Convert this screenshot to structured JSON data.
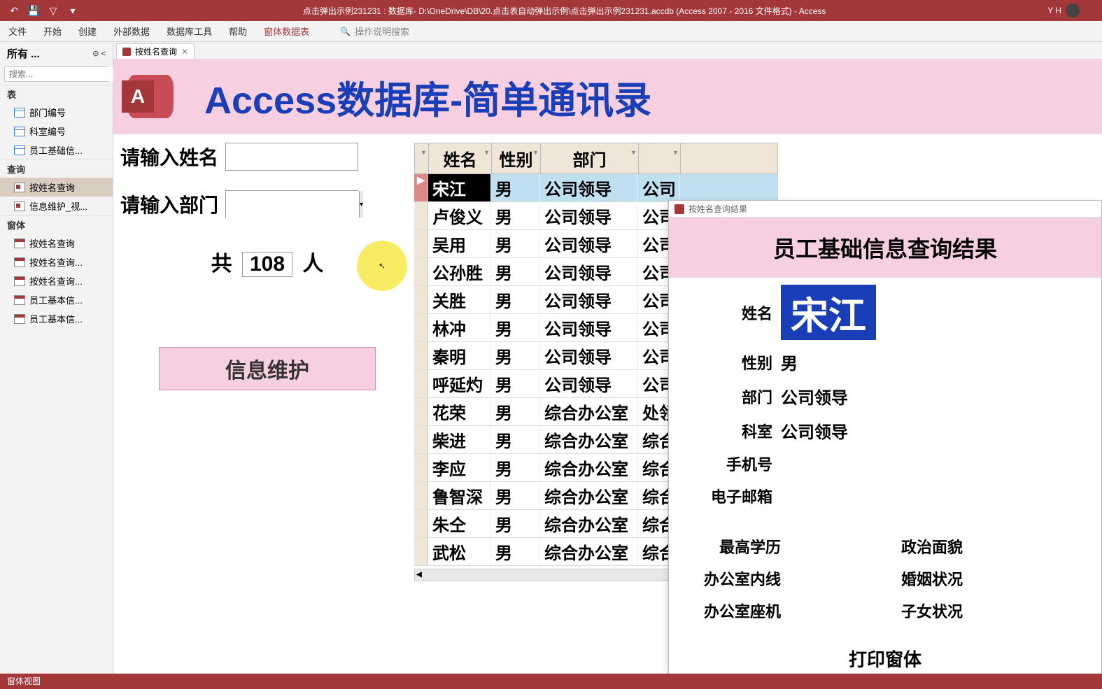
{
  "titlebar": {
    "title": "点击弹出示例231231 : 数据库- D:\\OneDrive\\DB\\20.点击表自动弹出示例\\点击弹出示例231231.accdb (Access 2007 - 2016 文件格式)  -  Access",
    "user": "Y H"
  },
  "ribbon": {
    "tabs": [
      "文件",
      "开始",
      "创建",
      "外部数据",
      "数据库工具",
      "帮助",
      "窗体数据表"
    ],
    "active": 6,
    "search_placeholder": "操作说明搜索"
  },
  "nav": {
    "title": "所有 ...",
    "search_placeholder": "搜索...",
    "groups": [
      {
        "name": "表",
        "type": "table",
        "items": [
          "部门编号",
          "科室编号",
          "员工基础信..."
        ]
      },
      {
        "name": "查询",
        "type": "query",
        "items": [
          "按姓名查询",
          "信息维护_视..."
        ],
        "selected": 0
      },
      {
        "name": "窗体",
        "type": "form",
        "items": [
          "按姓名查询",
          "按姓名查询...",
          "按姓名查询...",
          "员工基本信...",
          "员工基本信..."
        ]
      }
    ]
  },
  "doc_tab": {
    "label": "按姓名查询"
  },
  "form": {
    "banner_title": "Access数据库-简单通讯录",
    "name_label": "请输入姓名",
    "dept_label": "请输入部门",
    "count_prefix": "共",
    "count_value": "108",
    "count_suffix": "人",
    "maint_button": "信息维护"
  },
  "table": {
    "headers": [
      "姓名",
      "性别",
      "部门",
      ""
    ],
    "rows": [
      {
        "name": "宋江",
        "sex": "男",
        "dept": "公司领导",
        "extra": "公司",
        "selected": true
      },
      {
        "name": "卢俊义",
        "sex": "男",
        "dept": "公司领导",
        "extra": "公司"
      },
      {
        "name": "吴用",
        "sex": "男",
        "dept": "公司领导",
        "extra": "公司"
      },
      {
        "name": "公孙胜",
        "sex": "男",
        "dept": "公司领导",
        "extra": "公司"
      },
      {
        "name": "关胜",
        "sex": "男",
        "dept": "公司领导",
        "extra": "公司"
      },
      {
        "name": "林冲",
        "sex": "男",
        "dept": "公司领导",
        "extra": "公司"
      },
      {
        "name": "秦明",
        "sex": "男",
        "dept": "公司领导",
        "extra": "公司"
      },
      {
        "name": "呼延灼",
        "sex": "男",
        "dept": "公司领导",
        "extra": "公司"
      },
      {
        "name": "花荣",
        "sex": "男",
        "dept": "综合办公室",
        "extra": "处领"
      },
      {
        "name": "柴进",
        "sex": "男",
        "dept": "综合办公室",
        "extra": "综合"
      },
      {
        "name": "李应",
        "sex": "男",
        "dept": "综合办公室",
        "extra": "综合"
      },
      {
        "name": "鲁智深",
        "sex": "男",
        "dept": "综合办公室",
        "extra": "综合"
      },
      {
        "name": "朱仝",
        "sex": "男",
        "dept": "综合办公室",
        "extra": "综合"
      },
      {
        "name": "武松",
        "sex": "男",
        "dept": "综合办公室",
        "extra": "综合"
      }
    ]
  },
  "popup": {
    "tab_title": "按姓名查询结果",
    "header": "员工基础信息查询结果",
    "fields": {
      "name_lbl": "姓名",
      "name_val": "宋江",
      "sex_lbl": "性别",
      "sex_val": "男",
      "dept_lbl": "部门",
      "dept_val": "公司领导",
      "room_lbl": "科室",
      "room_val": "公司领导",
      "phone_lbl": "手机号",
      "email_lbl": "电子邮箱",
      "edu_lbl": "最高学历",
      "pol_lbl": "政治面貌",
      "line_lbl": "办公室内线",
      "mar_lbl": "婚姻状况",
      "tel_lbl": "办公室座机",
      "child_lbl": "子女状况",
      "print_lbl": "打印窗体"
    }
  },
  "statusbar": {
    "text": "窗体视图"
  }
}
